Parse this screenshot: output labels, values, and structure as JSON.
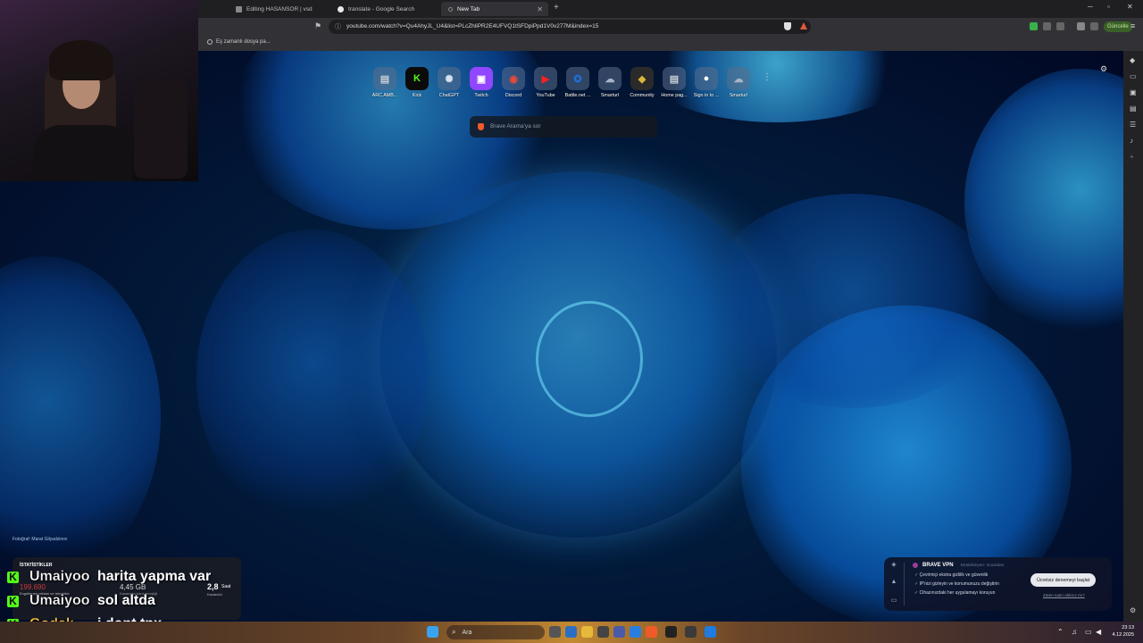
{
  "tabs": [
    {
      "label": "Editing HASANSÖR | vsd",
      "active": false
    },
    {
      "label": "translate - Google Search",
      "active": false
    },
    {
      "label": "New Tab",
      "active": true
    }
  ],
  "address_bar": {
    "url": "youtube.com/watch?v=Qu4AhyJL_U4&list=PLcZhliPR2E4UFVQ1tSFDpiPpd1V0v277M&index=15"
  },
  "update_button": "Güncelle",
  "bookmarks_bar": {
    "item": "Eş zamanlı dosya pa..."
  },
  "shortcuts": [
    {
      "name": "ARC AMB...",
      "icon": "page-icon",
      "color": "#c8cdd6",
      "glyph": "▤"
    },
    {
      "name": "Kick",
      "icon": "kick-icon",
      "color": "#53fc18",
      "glyph": "K"
    },
    {
      "name": "ChatGPT",
      "icon": "chatgpt-icon",
      "color": "#d8e4ee",
      "glyph": "✺"
    },
    {
      "name": "Twitch",
      "icon": "twitch-icon",
      "color": "#9146ff",
      "glyph": "▣"
    },
    {
      "name": "Discord",
      "icon": "chrome-icon",
      "color": "#e84a3a",
      "glyph": "◉"
    },
    {
      "name": "YouTube",
      "icon": "youtube-icon",
      "color": "#ff0000",
      "glyph": "▶"
    },
    {
      "name": "Battle.net ...",
      "icon": "battlenet-icon",
      "color": "#1e6fd9",
      "glyph": "✪"
    },
    {
      "name": "Smarturl",
      "icon": "cloud-icon",
      "color": "#aab4c8",
      "glyph": "☁"
    },
    {
      "name": "Community",
      "icon": "community-icon",
      "color": "#d9b53a",
      "glyph": "◆"
    },
    {
      "name": "Home pag...",
      "icon": "page-icon",
      "color": "#c8cdd6",
      "glyph": "▤"
    },
    {
      "name": "Sign in to ...",
      "icon": "github-icon",
      "color": "#ffffff",
      "glyph": "●"
    },
    {
      "name": "Smarturl",
      "icon": "cloud-icon",
      "color": "#aab4c8",
      "glyph": "☁"
    }
  ],
  "search": {
    "placeholder": "Brave Arama'ya sor"
  },
  "photo_credit": "Fotoğraf: Marat Gilyadzinov",
  "vpn": {
    "title": "BRAVE VPN",
    "powered": "Destekleyen: Guardian",
    "bullets": [
      "Çevrimiçi ekstra gizlilik ve güvenlik",
      "IP'nizi gizleyin ve konumunuzu değiştirin",
      "Cihazınızdaki her uygulamayı koruyun"
    ],
    "cta": "Ücretsiz denemeyi başlat",
    "link": "Zaten satın aldınız mı?"
  },
  "stats": {
    "header": "İSTATİSTİKLER",
    "value1": "199.690",
    "label1": "Engellenen reklam ve izleyiciler",
    "value2": "4,45 GB",
    "label2": "Kazanılan bant genişliği",
    "value3": "2,8",
    "unit3": "Saat",
    "label3": "Kazanıldı"
  },
  "chat": [
    {
      "user": "Umaiyoo",
      "message": "harita yapma var",
      "user_color": "#ffffff"
    },
    {
      "user": "Umaiyoo",
      "message": "sol altda",
      "user_color": "#ffffff"
    },
    {
      "user": "Godak",
      "message": "i dont tnx",
      "user_color": "#f6c343"
    }
  ],
  "taskbar": {
    "search_placeholder": "Ara"
  },
  "clock": {
    "time": "23:13",
    "date": "4.12.2025"
  }
}
